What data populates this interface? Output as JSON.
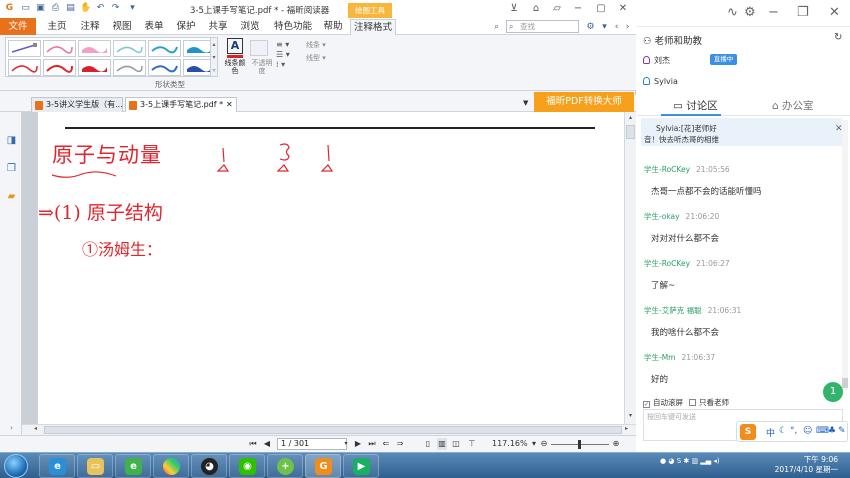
{
  "window": {
    "title": "3-5上课手写笔记.pdf * - 福昕阅读器",
    "context_tab": "绘图工具"
  },
  "menu": {
    "items": [
      "文件",
      "主页",
      "注释",
      "视图",
      "表单",
      "保护",
      "共享",
      "浏览",
      "特色功能",
      "帮助",
      "注释格式"
    ],
    "search_placeholder": "查找"
  },
  "ribbon": {
    "line_color_label": "线条颜色",
    "fill_label": "填充",
    "opacity_label": "不透明度",
    "line_style_label": "线条",
    "line_shape_label": "线型",
    "group_label": "形状类型"
  },
  "doc_tabs": [
    {
      "label": "3-5讲义学生版（有..."
    },
    {
      "label": "3-5上课手写笔记.pdf *"
    }
  ],
  "promo": "福昕PDF转换大师",
  "handwriting": {
    "title": "原子与动量",
    "section": "⇒(1) 原子结构",
    "item": "①汤姆生："
  },
  "statusbar": {
    "page": "1 / 301",
    "zoom": "117.16%"
  },
  "chat": {
    "teacher_header": "老师和助教",
    "people": [
      {
        "name": "刘杰",
        "badge": "直播中"
      },
      {
        "name": "Sylvia"
      }
    ],
    "tabs": {
      "discussion": "讨论区",
      "office": "办公室"
    },
    "pinned_line1": "Sylvia:[花]老师好",
    "pinned_line2": "音！快去听杰哥的相维",
    "messages": [
      {
        "sender": "学生-RoCKey",
        "time": "21:05:56",
        "text": "杰哥一点都不会的话能听懂吗"
      },
      {
        "sender": "学生-okay",
        "time": "21:06:20",
        "text": "对对对什么都不会"
      },
      {
        "sender": "学生-RoCKey",
        "time": "21:06:27",
        "text": "了解~"
      },
      {
        "sender": "学生-艾萨克 福聪",
        "time": "21:06:31",
        "text": "我的啥什么都不会"
      },
      {
        "sender": "学生-Mm",
        "time": "21:06:37",
        "text": "好的"
      }
    ],
    "auto_scroll": "自动滚屏",
    "teacher_only": "只看老师",
    "input_placeholder": "按回车键可发送",
    "unread_badge": "1",
    "ime": {
      "logo": "S",
      "lang": "中"
    }
  },
  "taskbar": {
    "clock_time": "下午 9:06",
    "clock_date": "2017/4/10 星期一"
  },
  "colors": {
    "accent_orange": "#e8721c",
    "ink_red": "#e0262d",
    "chat_green": "#2a9d6a",
    "chat_blue": "#3d8fe0"
  }
}
